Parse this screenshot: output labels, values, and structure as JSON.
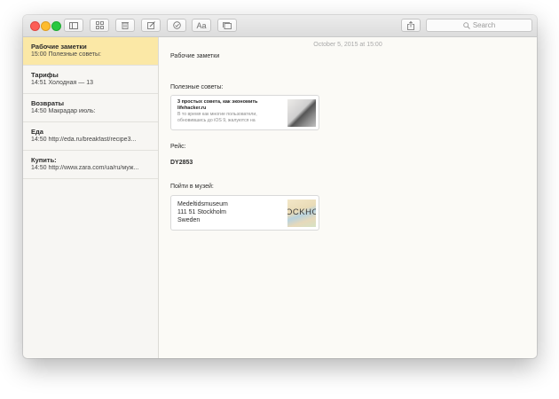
{
  "toolbar": {
    "font_button_label": "Aa",
    "search_placeholder": "Search",
    "icons": [
      "sidebar-toggle-icon",
      "grid-view-icon",
      "trash-icon",
      "compose-icon",
      "checklist-icon",
      "font-format-icon",
      "attachments-icon",
      "share-icon",
      "search-icon"
    ]
  },
  "sidebar": {
    "items": [
      {
        "title": "Рабочие заметки",
        "subtitle": "15:00  Полезные советы:"
      },
      {
        "title": "Тарифы",
        "subtitle": "14:51  Холодная — 13"
      },
      {
        "title": "Возвраты",
        "subtitle": "14:50  Макрадар июль:"
      },
      {
        "title": "Еда",
        "subtitle": "14:50  http://eda.ru/breakfast/recipe3..."
      },
      {
        "title": "Купить:",
        "subtitle": "14:50  http://www.zara.com/ua/ru/муж..."
      }
    ]
  },
  "note": {
    "date": "October 5, 2015 at 15:00",
    "title": "Рабочие заметки",
    "tips_label": "Полезные советы:",
    "link_card": {
      "title": "3 простых совета, как экономить lifehacker.ru",
      "description": "В то время как многие пользователи, обновившись до iOS 9, жалуются на"
    },
    "flight_label": "Рейс:",
    "flight_number": "DY2853",
    "museum_label": "Пойти в музей:",
    "map_card": {
      "name": "Medeltidsmuseum",
      "address_line": "111 51 Stockholm",
      "country": "Sweden",
      "map_text": "OCKHO"
    }
  },
  "colors": {
    "selected_note": "#fbe8a6",
    "traffic_red": "#fc5f57",
    "traffic_yellow": "#fdbc2e",
    "traffic_green": "#29c840"
  }
}
